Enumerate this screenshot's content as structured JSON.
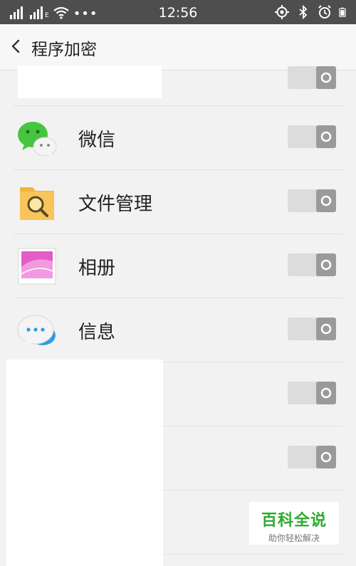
{
  "status_bar": {
    "time": "12:56",
    "signal_label": "E",
    "more": "•••",
    "icons": [
      "signal-icon",
      "signal-icon",
      "wifi-icon",
      "location-icon",
      "bluetooth-icon",
      "alarm-icon",
      "battery-icon"
    ]
  },
  "header": {
    "title": "程序加密"
  },
  "apps": [
    {
      "label": "微信",
      "icon": "wechat-icon",
      "enabled": false
    },
    {
      "label": "文件管理",
      "icon": "file-manager-icon",
      "enabled": false
    },
    {
      "label": "相册",
      "icon": "gallery-icon",
      "enabled": false
    },
    {
      "label": "信息",
      "icon": "messages-icon",
      "enabled": false
    }
  ],
  "watermark": {
    "main": "百科全说",
    "sub": "助你轻松解决"
  },
  "colors": {
    "status_bar": "#4e4e4e",
    "background": "#f2f2f2",
    "toggle_off": "#dddddd",
    "watermark_green": "#2eaa2e"
  }
}
